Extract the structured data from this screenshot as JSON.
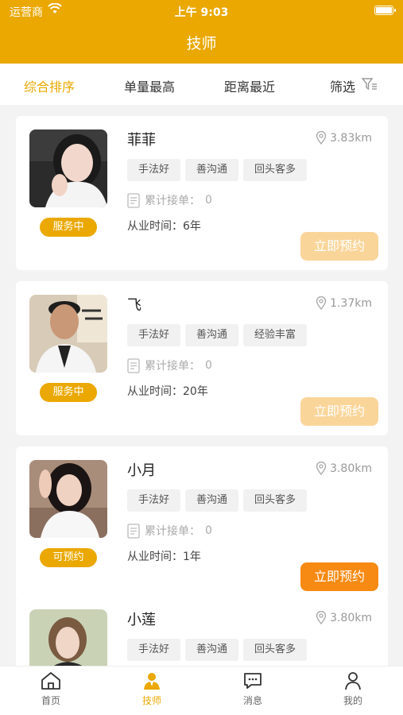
{
  "status_bar": {
    "carrier": "运营商",
    "time": "上午 9:03"
  },
  "nav": {
    "title": "技师"
  },
  "sort": {
    "comprehensive": "综合排序",
    "volume": "单量最高",
    "distance": "距离最近",
    "filter": "筛选"
  },
  "card_labels": {
    "orders_prefix": "累计接单：",
    "years_prefix": "从业时间：",
    "book": "立即预约"
  },
  "technicians": [
    {
      "name": "菲菲",
      "distance": "3.83km",
      "tags": [
        "手法好",
        "善沟通",
        "回头客多"
      ],
      "orders": "0",
      "years": "6年",
      "status": "服务中"
    },
    {
      "name": "飞",
      "distance": "1.37km",
      "tags": [
        "手法好",
        "善沟通",
        "经验丰富"
      ],
      "orders": "0",
      "years": "20年",
      "status": "服务中"
    },
    {
      "name": "小月",
      "distance": "3.80km",
      "tags": [
        "手法好",
        "善沟通",
        "回头客多"
      ],
      "orders": "0",
      "years": "1年",
      "status": "可预约"
    },
    {
      "name": "小莲",
      "distance": "3.80km",
      "tags": [
        "手法好",
        "善沟通",
        "回头客多"
      ]
    }
  ],
  "tabbar": {
    "home": "首页",
    "tech": "技师",
    "msg": "消息",
    "mine": "我的"
  },
  "colors": {
    "brand": "#eaa800",
    "book_active": "#f78a12",
    "book_disabled": "#fad59a"
  }
}
